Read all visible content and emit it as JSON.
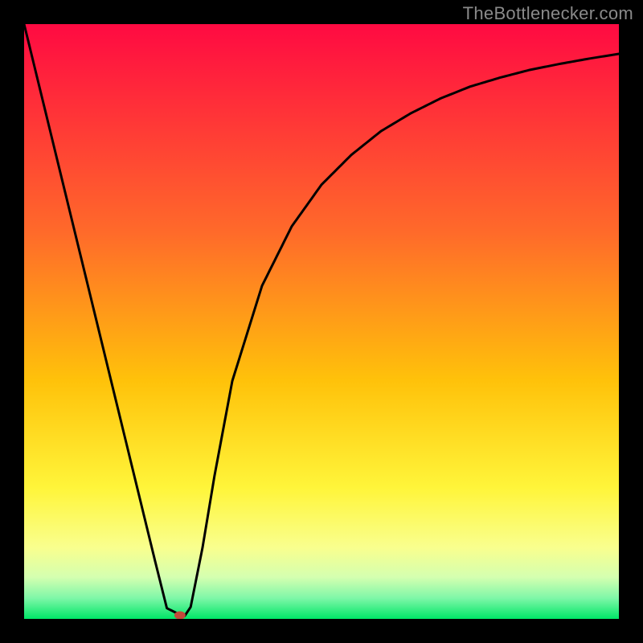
{
  "watermark": {
    "text": "TheBottlenecker.com"
  },
  "chart_data": {
    "type": "line",
    "title": "",
    "xlabel": "",
    "ylabel": "",
    "xlim": [
      0,
      100
    ],
    "ylim": [
      0,
      100
    ],
    "gradient_stops": [
      {
        "offset": 0,
        "color": "#ff0a42"
      },
      {
        "offset": 35,
        "color": "#ff6a2a"
      },
      {
        "offset": 60,
        "color": "#ffc20a"
      },
      {
        "offset": 78,
        "color": "#fff53a"
      },
      {
        "offset": 88,
        "color": "#f9ff8e"
      },
      {
        "offset": 93,
        "color": "#d4ffb0"
      },
      {
        "offset": 96.5,
        "color": "#7ff7a8"
      },
      {
        "offset": 100,
        "color": "#00e667"
      }
    ],
    "curve": {
      "x": [
        0,
        5,
        10,
        15,
        20,
        22,
        24,
        26,
        27,
        28,
        30,
        32,
        35,
        40,
        45,
        50,
        55,
        60,
        65,
        70,
        75,
        80,
        85,
        90,
        95,
        100
      ],
      "y": [
        100,
        79.5,
        59,
        38.5,
        18,
        9.8,
        1.8,
        0.8,
        0.5,
        2,
        12,
        24,
        40,
        56,
        66,
        73,
        78,
        82,
        85,
        87.5,
        89.5,
        91,
        92.3,
        93.3,
        94.2,
        95
      ]
    },
    "marker": {
      "x": 26.2,
      "y": 0.6,
      "color": "#c24a3a"
    }
  }
}
